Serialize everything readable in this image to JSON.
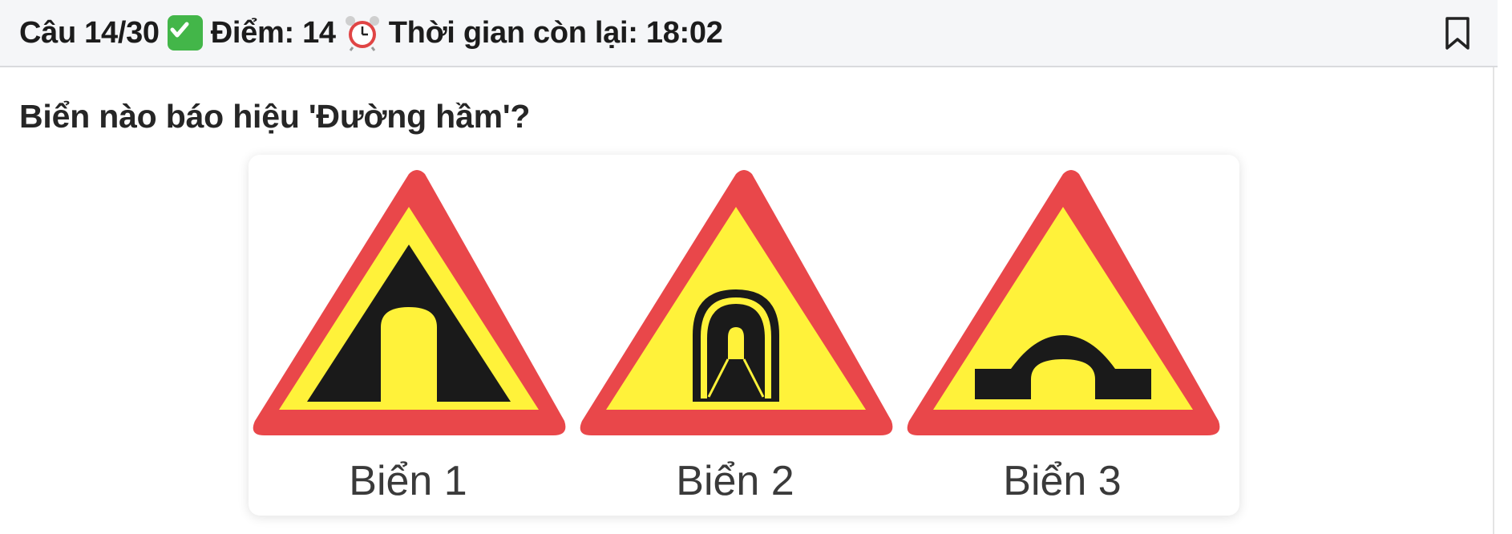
{
  "header": {
    "question_counter": "Câu 14/30",
    "score_text": "Điểm: 14",
    "timer_text": "Thời gian còn lại: 18:02",
    "icons": [
      "check-icon",
      "alarm-clock-icon",
      "bookmark-icon"
    ]
  },
  "question": {
    "text": "Biển nào báo hiệu 'Đường hầm'?"
  },
  "image": {
    "signs": [
      {
        "label": "Biển 1"
      },
      {
        "label": "Biển 2"
      },
      {
        "label": "Biển 3"
      }
    ]
  },
  "colors": {
    "sign_border": "#e9474a",
    "sign_fill": "#fff23a",
    "symbol": "#1a1a1a",
    "check": "#43b649"
  }
}
